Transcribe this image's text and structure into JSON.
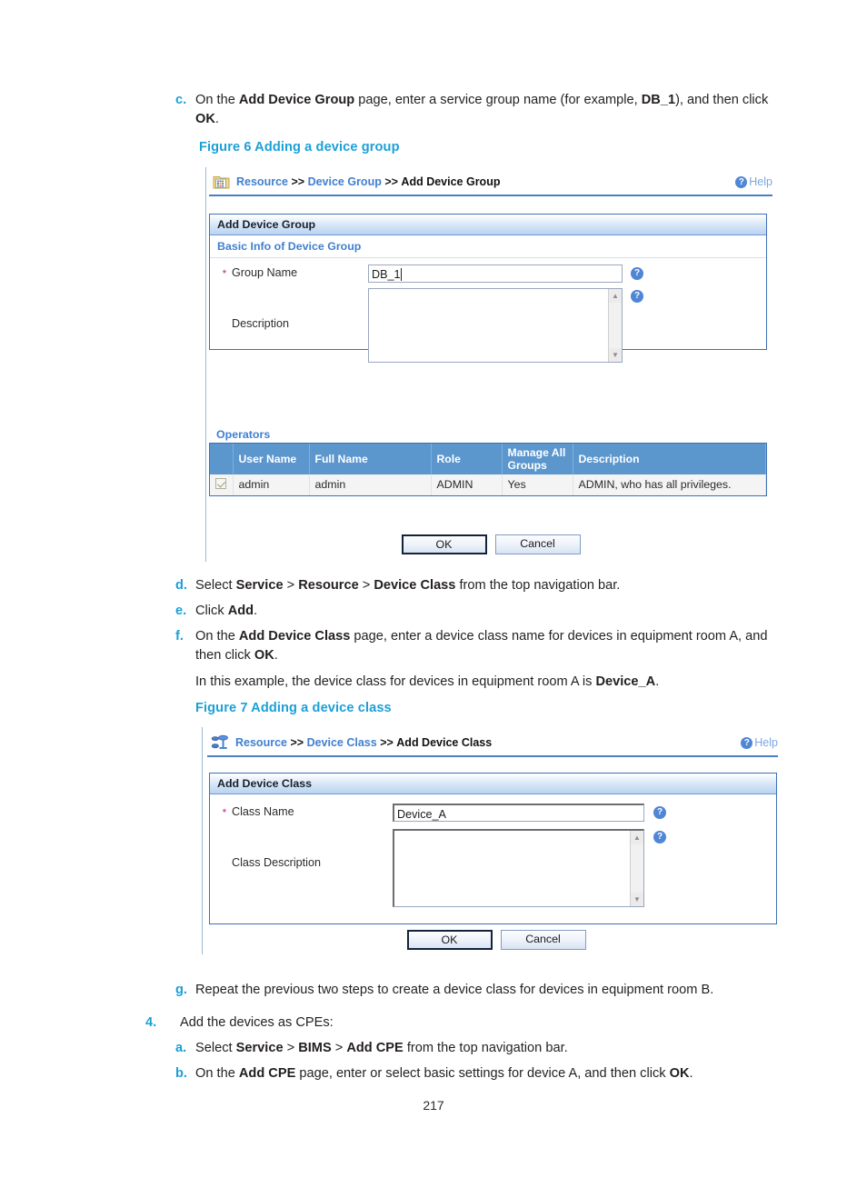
{
  "page": {
    "number": "217"
  },
  "steps": {
    "c": {
      "marker": "c.",
      "seg1": "On the ",
      "bold1": "Add Device Group",
      "seg2": " page, enter a service group name (for example, ",
      "bold2": "DB_1",
      "seg3": "), and then click ",
      "bold3": "OK",
      "seg4": "."
    },
    "d": {
      "marker": "d.",
      "seg1": "Select ",
      "bold1": "Service",
      "seg2": " > ",
      "bold2": "Resource",
      "seg3": " > ",
      "bold3": "Device Class",
      "seg4": " from the top navigation bar."
    },
    "e": {
      "marker": "e.",
      "seg1": "Click ",
      "bold1": "Add",
      "seg2": "."
    },
    "f": {
      "marker": "f.",
      "seg1": "On the ",
      "bold1": "Add Device Class",
      "seg2": " page, enter a device class name for devices in equipment room A, and then click ",
      "bold2": "OK",
      "seg3": ".",
      "note_seg1": "In this example, the device class for devices in equipment room A is ",
      "note_bold": "Device_A",
      "note_seg2": "."
    },
    "g": {
      "marker": "g.",
      "text": "Repeat the previous two steps to create a device class for devices in equipment room B."
    },
    "four": {
      "marker": "4.",
      "text": "Add the devices as CPEs:"
    },
    "four_a": {
      "marker": "a.",
      "seg1": "Select ",
      "bold1": "Service",
      "seg2": " > ",
      "bold2": "BIMS",
      "seg3": " > ",
      "bold3": "Add CPE",
      "seg4": " from the top navigation bar."
    },
    "four_b": {
      "marker": "b.",
      "seg1": "On the ",
      "bold1": "Add CPE",
      "seg2": " page, enter or select basic settings for device A, and then click ",
      "bold2": "OK",
      "seg3": "."
    }
  },
  "figure6": {
    "caption": "Figure 6 Adding a device group",
    "breadcrumb": {
      "icon": "folder-grid-icon",
      "item1": "Resource",
      "sep1": ">>",
      "item2": "Device Group",
      "sep2": ">>",
      "current": "Add Device Group"
    },
    "help_label": "Help",
    "panel_title": "Add Device Group",
    "section_label": "Basic Info of Device Group",
    "fields": {
      "group_name_label": "Group Name",
      "group_name_value": "DB_1",
      "description_label": "Description",
      "description_value": ""
    },
    "operators_label": "Operators",
    "table": {
      "columns": [
        "",
        "User Name",
        "Full Name",
        "Role",
        "Manage All Groups",
        "Description"
      ],
      "rows": [
        {
          "selected": true,
          "user_name": "admin",
          "full_name": "admin",
          "role": "ADMIN",
          "manage_all_groups": "Yes",
          "description": "ADMIN, who has all privileges."
        }
      ]
    },
    "buttons": {
      "ok": "OK",
      "cancel": "Cancel"
    }
  },
  "figure7": {
    "caption": "Figure 7 Adding a device class",
    "breadcrumb": {
      "icon": "device-class-icon",
      "item1": "Resource",
      "sep1": ">>",
      "item2": "Device Class",
      "sep2": ">>",
      "current": "Add Device Class"
    },
    "help_label": "Help",
    "panel_title": "Add Device Class",
    "fields": {
      "class_name_label": "Class Name",
      "class_name_value": "Device_A",
      "class_description_label": "Class Description",
      "class_description_value": ""
    },
    "buttons": {
      "ok": "OK",
      "cancel": "Cancel"
    }
  },
  "colors": {
    "accent_blue": "#1ba0d7",
    "link_blue": "#3f7fd0",
    "table_header": "#5b96cd",
    "required_star": "#b4308f"
  }
}
